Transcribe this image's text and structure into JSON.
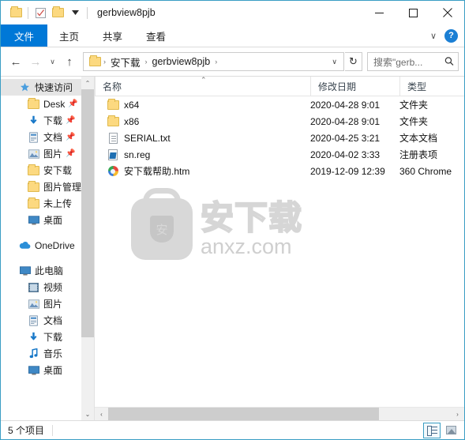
{
  "window": {
    "title": "gerbview8pjb",
    "quick_access_toolbar": [
      {
        "name": "folder-properties-icon",
        "label": ""
      },
      {
        "name": "properties-checkbox-icon",
        "label": ""
      },
      {
        "name": "new-folder-icon",
        "label": ""
      },
      {
        "name": "customize-qat-chevron",
        "label": "▾"
      }
    ],
    "controls": {
      "minimize": "—",
      "maximize": "☐",
      "close": "✕"
    }
  },
  "ribbon": {
    "tabs": [
      {
        "label": "文件",
        "active": true
      },
      {
        "label": "主页",
        "active": false
      },
      {
        "label": "共享",
        "active": false
      },
      {
        "label": "查看",
        "active": false
      }
    ],
    "collapse_chevron": "∨",
    "help_label": "?"
  },
  "address": {
    "back": "←",
    "forward": "→",
    "recent_chevron": "∨",
    "up": "↑",
    "breadcrumbs": [
      "安下载",
      "gerbview8pjb"
    ],
    "separator": "›",
    "dropdown_chevron": "∨",
    "refresh": "↻"
  },
  "search": {
    "placeholder": "搜索\"gerb..."
  },
  "sidebar": {
    "groups": [
      {
        "header": {
          "label": "快速访问",
          "icon": "star-icon",
          "selected": true
        },
        "items": [
          {
            "label": "Desk",
            "icon": "folder-icon",
            "pinned": true
          },
          {
            "label": "下载",
            "icon": "download-icon",
            "pinned": true
          },
          {
            "label": "文档",
            "icon": "documents-icon",
            "pinned": true
          },
          {
            "label": "图片",
            "icon": "pictures-icon",
            "pinned": true
          },
          {
            "label": "安下载",
            "icon": "folder-icon",
            "pinned": false
          },
          {
            "label": "图片管理",
            "icon": "folder-icon",
            "pinned": false
          },
          {
            "label": "未上传",
            "icon": "folder-icon",
            "pinned": false
          },
          {
            "label": "桌面",
            "icon": "desktop-icon",
            "pinned": false
          }
        ]
      },
      {
        "header": {
          "label": "OneDrive",
          "icon": "cloud-icon",
          "selected": false
        },
        "items": []
      },
      {
        "header": {
          "label": "此电脑",
          "icon": "computer-icon",
          "selected": false
        },
        "items": [
          {
            "label": "视频",
            "icon": "videos-icon",
            "pinned": false
          },
          {
            "label": "图片",
            "icon": "pictures-icon",
            "pinned": false
          },
          {
            "label": "文档",
            "icon": "documents-icon",
            "pinned": false
          },
          {
            "label": "下载",
            "icon": "download-icon",
            "pinned": false
          },
          {
            "label": "音乐",
            "icon": "music-icon",
            "pinned": false
          },
          {
            "label": "桌面",
            "icon": "desktop-icon",
            "pinned": false
          }
        ]
      }
    ]
  },
  "filelist": {
    "columns": [
      {
        "label": "名称",
        "sorted": true,
        "sort_direction": "asc"
      },
      {
        "label": "修改日期",
        "sorted": false
      },
      {
        "label": "类型",
        "sorted": false
      }
    ],
    "sort_indicator": "⌃",
    "rows": [
      {
        "name": "x64",
        "date": "2020-04-28 9:01",
        "type": "文件夹",
        "icon": "folder-icon"
      },
      {
        "name": "x86",
        "date": "2020-04-28 9:01",
        "type": "文件夹",
        "icon": "folder-icon"
      },
      {
        "name": "SERIAL.txt",
        "date": "2020-04-25 3:21",
        "type": "文本文档",
        "icon": "text-document-icon"
      },
      {
        "name": "sn.reg",
        "date": "2020-04-02 3:33",
        "type": "注册表项",
        "icon": "registry-file-icon"
      },
      {
        "name": "安下载帮助.htm",
        "date": "2019-12-09 12:39",
        "type": "360 Chrome",
        "icon": "html-document-icon"
      }
    ]
  },
  "watermark": {
    "cn_text": "安下载",
    "en_text": "anxz.com",
    "shield_glyph": "安"
  },
  "scrollbars": {
    "sidebar_up": "⌃",
    "sidebar_down": "⌄",
    "h_left": "‹",
    "h_right": "›"
  },
  "statusbar": {
    "item_count": "5 个项目",
    "views": [
      {
        "name": "details-view",
        "active": true
      },
      {
        "name": "thumbnails-view",
        "active": false
      }
    ]
  }
}
